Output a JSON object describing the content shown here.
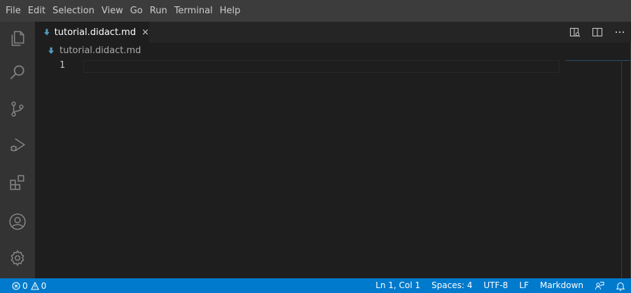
{
  "menu": [
    "File",
    "Edit",
    "Selection",
    "View",
    "Go",
    "Run",
    "Terminal",
    "Help"
  ],
  "activity": [
    "explorer-icon",
    "search-icon",
    "source-control-icon",
    "run-debug-icon",
    "extensions-icon",
    "accounts-icon",
    "manage-gear-icon"
  ],
  "tab": {
    "label": "tutorial.didact.md",
    "close": "×",
    "active": true
  },
  "breadcrumb": {
    "label": "tutorial.didact.md"
  },
  "editor": {
    "line_number": "1",
    "content": ""
  },
  "status": {
    "errors": "0",
    "warnings": "0",
    "position": "Ln 1, Col 1",
    "spaces": "Spaces: 4",
    "encoding": "UTF-8",
    "eol": "LF",
    "language": "Markdown"
  },
  "colors": {
    "statusbar": "#007acc",
    "menubar": "#3c3c3c",
    "activitybar": "#333333",
    "editor": "#1e1e1e",
    "markdown_icon": "#519aba"
  }
}
